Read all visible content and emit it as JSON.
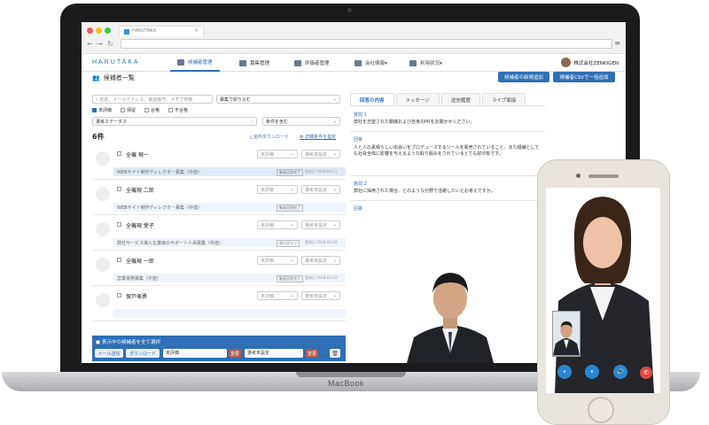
{
  "browser": {
    "tab_title": "HARUTAKA",
    "tab_close": "×"
  },
  "app": {
    "logo": "HARUTAKA",
    "nav": [
      {
        "label": "候補者管理",
        "active": true
      },
      {
        "label": "募集管理",
        "active": false
      },
      {
        "label": "評価者管理",
        "active": false
      },
      {
        "label": "会社情報▾",
        "active": false
      },
      {
        "label": "利用状況▾",
        "active": false
      }
    ],
    "company": "株式会社ZENKIGEN"
  },
  "page": {
    "title": "候補者一覧",
    "new_button": "候補者の新規追加",
    "csv_button": "候補者CSVで一括追加"
  },
  "filters": {
    "search_placeholder": "氏名、メールアドレス、電話番号、メモで検索",
    "recruit_select": "募集で絞り込む",
    "statuses": [
      {
        "label": "未評価",
        "checked": true
      },
      {
        "label": "保留",
        "checked": false
      },
      {
        "label": "合格",
        "checked": false
      },
      {
        "label": "不合格",
        "checked": false
      }
    ],
    "selection_status": "選考ステータス",
    "condition": "条件を含む"
  },
  "list": {
    "count": "6件",
    "download": "全件ダウンロード",
    "advanced": "詳細条件を指定",
    "rows": [
      {
        "name": "全機 現一",
        "job": "WEBサイト制作ディレクター募集（中途）",
        "eval": "未評価",
        "status": "選考未設定",
        "badge": "動画回答完了",
        "date": "登録日 2018-04-11"
      },
      {
        "name": "全機現 二郎",
        "job": "WEBサイト制作ディレクター募集（中途）",
        "eval": "未評価",
        "status": "選考未設定",
        "badge": "動画回答完了",
        "date": ""
      },
      {
        "name": "全機現 愛子",
        "job": "弊社サービス導入企業様のサポート人員募集（中途）",
        "eval": "未評価",
        "status": "選考未設定",
        "badge": "未ログイン",
        "date": "登録日 2018-03-20"
      },
      {
        "name": "全機現 一郎",
        "job": "営業事務募集（中途）",
        "eval": "未評価",
        "status": "選考未設定",
        "badge": "動画回答完了",
        "date": "登録日 2018-03-20"
      },
      {
        "name": "保戸塚勇",
        "job": "",
        "eval": "未評価",
        "status": "選考未設定",
        "badge": "",
        "date": ""
      }
    ]
  },
  "footer": {
    "select_all": "表示中の候補者を全て選択",
    "mail": "メール送信",
    "download": "ダウンロード",
    "eval_select": "未評価",
    "apply1": "変更",
    "status_select": "選考未設定",
    "apply2": "変更"
  },
  "detail": {
    "tabs": [
      "回答の内容",
      "メッセージ",
      "送信履歴",
      "ライブ面接"
    ],
    "q1_label": "質問 1",
    "q1_text": "弊社を志望された動機および自身のPRをお聞かせください。",
    "a_label": "回答",
    "a1_text": "人と人の素晴らしい出会いをプロデュースするツールを販売されていること。また組織としても社会全体に影響を与えるような取り組みをされているとても好印象です。",
    "q2_label": "質問 2",
    "q2_text": "弊社に採用された場合、どのような分野で活躍したいとお考えですか。",
    "a2_label": "回答"
  },
  "laptop": {
    "brand": "MacBook"
  },
  "colors": {
    "accent": "#2e6fb5",
    "danger": "#e0473e"
  }
}
